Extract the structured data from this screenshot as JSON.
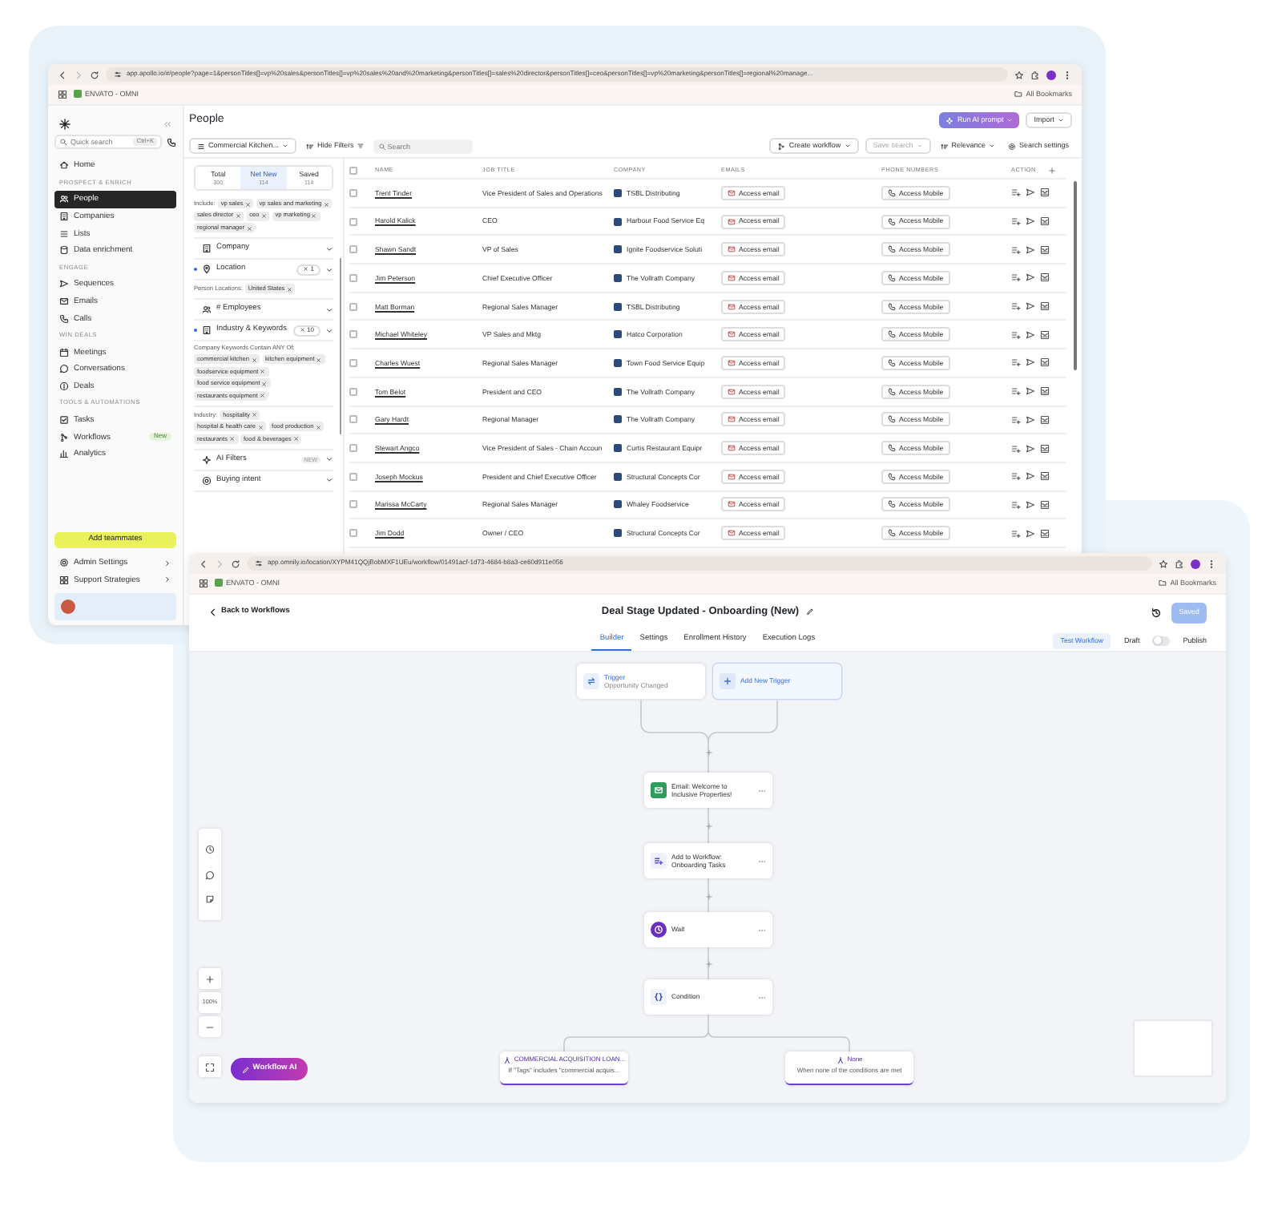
{
  "back_window": {
    "browser": {
      "url": "app.apollo.io/#/people?page=1&personTitles[]=vp%20sales&personTitles[]=vp%20sales%20and%20marketing&personTitles[]=sales%20director&personTitles[]=ceo&personTitles[]=vp%20marketing&personTitles[]=regional%20manage...",
      "bookmark": "ENVATO - OMNI",
      "all_bookmarks": "All Bookmarks"
    },
    "sidebar": {
      "quick_search": "Quick search",
      "shortcut": "Ctrl+K",
      "nav": [
        {
          "kind": "item",
          "label": "Home",
          "selected": false
        },
        {
          "kind": "heading",
          "label": "PROSPECT & ENRICH"
        },
        {
          "kind": "item",
          "label": "People",
          "selected": true
        },
        {
          "kind": "item",
          "label": "Companies",
          "selected": false
        },
        {
          "kind": "item",
          "label": "Lists",
          "selected": false
        },
        {
          "kind": "item",
          "label": "Data enrichment",
          "selected": false
        },
        {
          "kind": "heading",
          "label": "ENGAGE"
        },
        {
          "kind": "item",
          "label": "Sequences",
          "selected": false
        },
        {
          "kind": "item",
          "label": "Emails",
          "selected": false
        },
        {
          "kind": "item",
          "label": "Calls",
          "selected": false
        },
        {
          "kind": "heading",
          "label": "WIN DEALS"
        },
        {
          "kind": "item",
          "label": "Meetings",
          "selected": false
        },
        {
          "kind": "item",
          "label": "Conversations",
          "selected": false
        },
        {
          "kind": "item",
          "label": "Deals",
          "selected": false
        },
        {
          "kind": "heading",
          "label": "TOOLS & AUTOMATIONS"
        },
        {
          "kind": "item",
          "label": "Tasks",
          "selected": false
        },
        {
          "kind": "item",
          "label": "Workflows",
          "selected": false,
          "badge": "New"
        },
        {
          "kind": "item",
          "label": "Analytics",
          "selected": false
        }
      ],
      "add_button": "Add teammates",
      "footer": [
        "Admin Settings",
        "Support Strategies"
      ]
    },
    "header": {
      "title": "People",
      "ai_button": "Run AI prompt",
      "import_button": "Import"
    },
    "toolbar": {
      "list": "Commercial Kitchen...",
      "hide_filters": "Hide Filters",
      "search_placeholder": "Search",
      "create_workflow": "Create workflow",
      "save_search": "Save search",
      "sort": "Relevance",
      "settings": "Search settings"
    },
    "filters": {
      "tabs": [
        {
          "label": "Total",
          "count": "300",
          "selected": false
        },
        {
          "label": "Net New",
          "count": "114",
          "selected": true
        },
        {
          "label": "Saved",
          "count": "114",
          "selected": false
        }
      ],
      "groups": [
        {
          "kind": "chips",
          "label": "Include:",
          "chips": [
            "vp sales",
            "vp sales and marketing",
            "sales director",
            "ceo",
            "vp marketing",
            "regional manager"
          ]
        },
        {
          "kind": "section",
          "title": "Company",
          "active": false
        },
        {
          "kind": "section",
          "title": "Location",
          "count": "1",
          "active": true
        },
        {
          "kind": "chips",
          "label": "Person Locations:",
          "chips": [
            "United States"
          ]
        },
        {
          "kind": "section",
          "title": "# Employees",
          "active": false
        },
        {
          "kind": "section",
          "title": "Industry & Keywords",
          "count": "10",
          "active": true
        },
        {
          "kind": "chips",
          "label": "Company Keywords Contain ANY Of:",
          "chips": [
            "commercial kitchen",
            "kitchen equipment",
            "foodservice equipment",
            "food service equipment",
            "restaurants equipment"
          ]
        },
        {
          "kind": "chips",
          "label": "Industry:",
          "chips": [
            "hospitality",
            "hospital & health care",
            "food production",
            "restaurants",
            "food & beverages"
          ]
        },
        {
          "kind": "section",
          "title": "AI Filters",
          "badge": "NEW",
          "active": false
        },
        {
          "kind": "section",
          "title": "Buying intent",
          "active": false
        }
      ]
    },
    "table": {
      "columns": [
        "NAME",
        "JOB TITLE",
        "COMPANY",
        "EMAILS",
        "PHONE NUMBERS",
        "ACTION"
      ],
      "all_checked": false,
      "rows": [
        {
          "checked": false,
          "name": "Trent Tinder",
          "title": "Vice President of Sales and Operations",
          "company": "TSBL Distributing",
          "email": "Access email",
          "phone": "Access Mobile"
        },
        {
          "checked": false,
          "name": "Harold Kalick",
          "title": "CEO",
          "company": "Harbour Food Service Eq",
          "email": "Access email",
          "phone": "Access Mobile"
        },
        {
          "checked": false,
          "name": "Shawn Sandt",
          "title": "VP of Sales",
          "company": "Ignite Foodservice Soluti",
          "email": "Access email",
          "phone": "Access Mobile"
        },
        {
          "checked": false,
          "name": "Jim Peterson",
          "title": "Chief Executive Officer",
          "company": "The Vollrath Company",
          "email": "Access email",
          "phone": "Access Mobile"
        },
        {
          "checked": false,
          "name": "Matt Borman",
          "title": "Regional Sales Manager",
          "company": "TSBL Distributing",
          "email": "Access email",
          "phone": "Access Mobile"
        },
        {
          "checked": false,
          "name": "Michael Whiteley",
          "title": "VP Sales and Mktg",
          "company": "Hatco Corporation",
          "email": "Access email",
          "phone": "Access Mobile"
        },
        {
          "checked": false,
          "name": "Charles Wuest",
          "title": "Regional Sales Manager",
          "company": "Town Food Service Equip",
          "email": "Access email",
          "phone": "Access Mobile"
        },
        {
          "checked": false,
          "name": "Tom Belot",
          "title": "President and CEO",
          "company": "The Vollrath Company",
          "email": "Access email",
          "phone": "Access Mobile"
        },
        {
          "checked": false,
          "name": "Gary Hardt",
          "title": "Regional Manager",
          "company": "The Vollrath Company",
          "email": "Access email",
          "phone": "Access Mobile"
        },
        {
          "checked": false,
          "name": "Stewart Angco",
          "title": "Vice President of Sales - Chain Accoun",
          "company": "Curtis Restaurant Equipr",
          "email": "Access email",
          "phone": "Access Mobile"
        },
        {
          "checked": false,
          "name": "Joseph Mockus",
          "title": "President and Chief Executive Officer",
          "company": "Structural Concepts Cor",
          "email": "Access email",
          "phone": "Access Mobile"
        },
        {
          "checked": false,
          "name": "Marissa McCarty",
          "title": "Regional Sales Manager",
          "company": "Whaley Foodservice",
          "email": "Access email",
          "phone": "Access Mobile"
        },
        {
          "checked": false,
          "name": "Jim Dodd",
          "title": "Owner / CEO",
          "company": "Structural Concepts Cor",
          "email": "Access email",
          "phone": "Access Mobile"
        }
      ]
    }
  },
  "front_window": {
    "browser": {
      "url": "app.omnily.io/location/XYPM41QQjBobMXF1UEu/workflow/01491acf-1d73-4684-b8a3-ce60d911e056",
      "bookmark": "ENVATO - OMNI",
      "all_bookmarks": "All Bookmarks"
    },
    "back_link": "Back to Workflows",
    "title": "Deal Stage Updated - Onboarding (New)",
    "save_button": {
      "label": "Saved",
      "disabled": true
    },
    "tabs": [
      {
        "label": "Builder",
        "selected": true
      },
      {
        "label": "Settings",
        "selected": false
      },
      {
        "label": "Enrollment History",
        "selected": false
      },
      {
        "label": "Execution Logs",
        "selected": false
      }
    ],
    "test_button": "Test Workflow",
    "draft_label": "Draft",
    "publish_label": "Publish",
    "publish_toggle": {
      "on": false
    },
    "nodes": [
      {
        "kind": "trigger",
        "title": "Trigger",
        "subtitle": "Opportunity Changed"
      },
      {
        "kind": "add-trigger",
        "title": "Add New Trigger"
      },
      {
        "kind": "email",
        "title": "Email: Welcome to Inclusive Properties!"
      },
      {
        "kind": "add-to-workflow",
        "title": "Add to Workflow: Onboarding Tasks"
      },
      {
        "kind": "wait",
        "title": "Wait"
      },
      {
        "kind": "condition",
        "title": "Condition"
      }
    ],
    "branches": [
      {
        "title": "COMMERCIAL ACQUISITION LOAN...",
        "subtitle": "If \"Tags\" includes \"commercial acquis..."
      },
      {
        "title": "None",
        "subtitle": "When none of the conditions are met"
      }
    ],
    "zoom_label": "100%",
    "ai_button": "Workflow AI"
  }
}
